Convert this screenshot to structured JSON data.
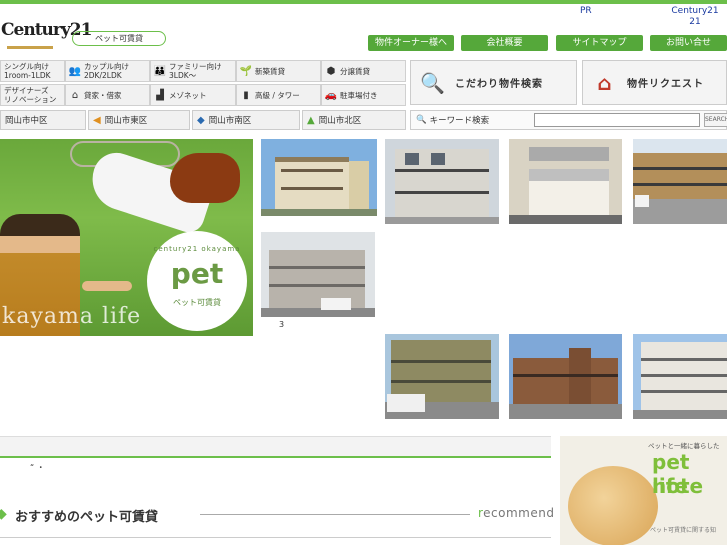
{
  "header": {
    "pr_link": "PR",
    "c21_link_line1": "Century21",
    "c21_link_line2": "21",
    "logo_text": "Century21",
    "pet_badge": "ペット可賃貸"
  },
  "global_nav": [
    {
      "label": "物件オーナー様へ"
    },
    {
      "label": "会社概要"
    },
    {
      "label": "サイトマップ"
    },
    {
      "label": "お問い合せ"
    }
  ],
  "category_grid": [
    {
      "line1": "シングル向け",
      "line2": "1room-1LDK",
      "icon": "person-icon"
    },
    {
      "line1": "カップル向け",
      "line2": "2DK/2LDK",
      "icon": "couple-icon"
    },
    {
      "line1": "ファミリー向け",
      "line2": "3LDK〜",
      "icon": "family-icon"
    },
    {
      "line1": "新築賃貸",
      "line2": "",
      "icon": "sprout-icon"
    },
    {
      "line1": "分譲賃貸",
      "line2": "",
      "icon": "cube-icon"
    },
    {
      "line1": "デザイナーズ",
      "line2": "リノベーション",
      "icon": "design-icon"
    },
    {
      "line1": "貸家・借家",
      "line2": "",
      "icon": "house-icon"
    },
    {
      "line1": "メゾネット",
      "line2": "",
      "icon": "stairs-icon"
    },
    {
      "line1": "高級 / タワー",
      "line2": "",
      "icon": "tower-icon"
    },
    {
      "line1": "駐車場付き",
      "line2": "",
      "icon": "car-icon"
    }
  ],
  "big_buttons": [
    {
      "label": "こだわり物件検索",
      "icon": "house-search-icon"
    },
    {
      "label": "物件リクエスト",
      "icon": "hands-house-icon"
    }
  ],
  "areas": [
    {
      "label": "岡山市中区"
    },
    {
      "label": "岡山市東区"
    },
    {
      "label": "岡山市南区"
    },
    {
      "label": "岡山市北区"
    }
  ],
  "search": {
    "label": "キーワード検索",
    "placeholder": "",
    "button": "SEARCH"
  },
  "hero": {
    "circle_top": "century21 okayama",
    "circle_big": "pet",
    "circle_sub": "ペット可賃貸",
    "tagline": "kayama life"
  },
  "photo_caption": "3",
  "misc_text": "“ ・",
  "recommend": {
    "title": "おすすめのペット可賃貸",
    "en_first": "r",
    "en_rest": "ecommend"
  },
  "note_banner": {
    "line1": "ペットと一緒に暮らした",
    "line2": "pet life",
    "line3": "note",
    "line4": "ペット可賃貸に関する知"
  },
  "colors": {
    "accent_green": "#55a83a",
    "light_green": "#6cbf4a",
    "link_blue": "#1a3aa0"
  }
}
